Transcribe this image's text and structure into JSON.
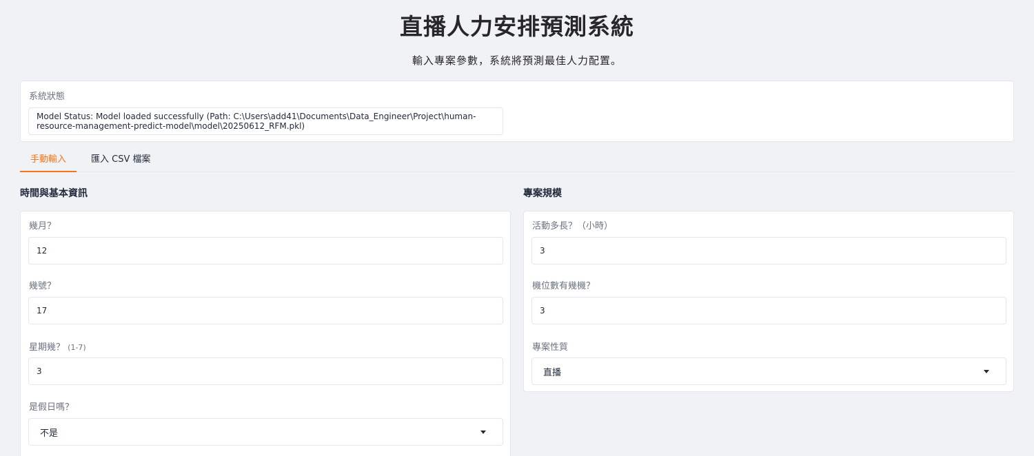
{
  "header": {
    "title": "直播人力安排預測系統",
    "subtitle": "輸入專案參數，系統將預測最佳人力配置。"
  },
  "status": {
    "label": "系統狀態",
    "value": "Model Status: Model loaded successfully (Path: C:\\Users\\add41\\Documents\\Data_Engineer\\Project\\human-resource-management-predict-model\\model\\20250612_RFM.pkl)"
  },
  "tabs": [
    {
      "label": "手動輸入",
      "active": true
    },
    {
      "label": "匯入 CSV 檔案",
      "active": false
    }
  ],
  "left_section": {
    "title": "時間與基本資訊",
    "fields": [
      {
        "label": "幾月？",
        "value": "12"
      },
      {
        "label": "幾號？",
        "value": "17"
      },
      {
        "label": "星期幾？",
        "hint": "(1-7)",
        "value": "3"
      },
      {
        "label": "是假日嗎？",
        "value": "不是"
      }
    ]
  },
  "right_section": {
    "title": "專案規模",
    "fields": [
      {
        "label": "活動多長？（小時）",
        "value": "3"
      },
      {
        "label": "機位數有幾機？",
        "value": "3"
      },
      {
        "label": "專案性質",
        "value": "直播"
      }
    ]
  },
  "colors": {
    "accent": "#f97316",
    "background": "#f1f2f6"
  },
  "icons": {
    "dropdown": "chevron-down-icon"
  }
}
